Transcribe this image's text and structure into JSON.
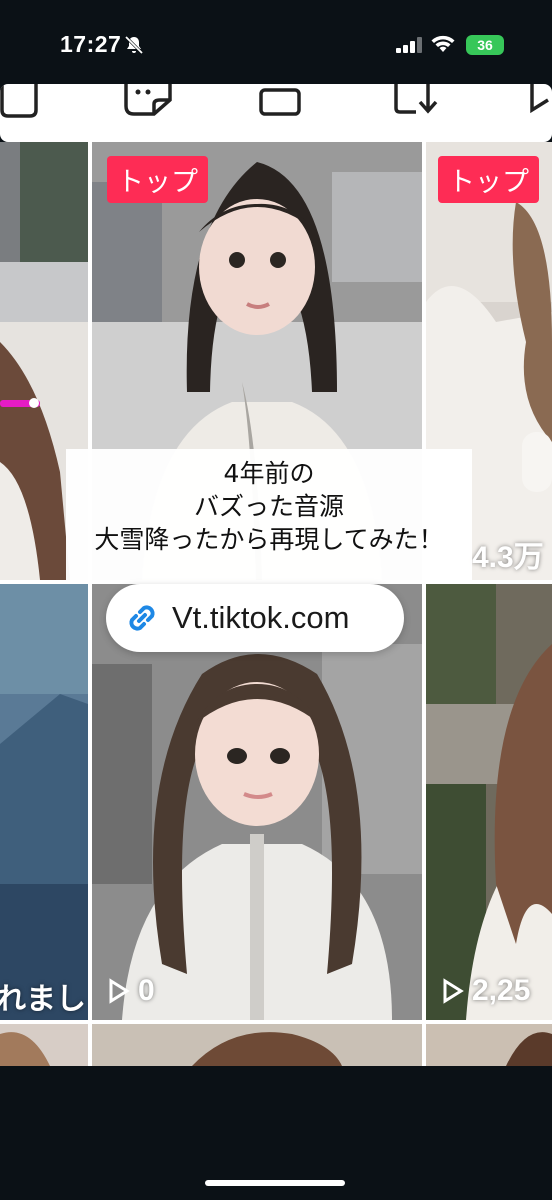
{
  "status_bar": {
    "time": "17:27",
    "battery": "36"
  },
  "grid": {
    "badges": [
      "トップ",
      "トップ"
    ],
    "row1_right_count": "4.3万",
    "row2_left_text": "れました",
    "row2_middle_count": "0",
    "row2_right_count": "2,25"
  },
  "caption": {
    "line1": "4年前の",
    "line2": "バズった音源",
    "line3": "大雪降ったから再現してみた！"
  },
  "link": {
    "text": "Vt.tiktok.com"
  },
  "colors": {
    "badge": "#fe2c55",
    "link_icon": "#1e88e5",
    "battery": "#37c759"
  }
}
